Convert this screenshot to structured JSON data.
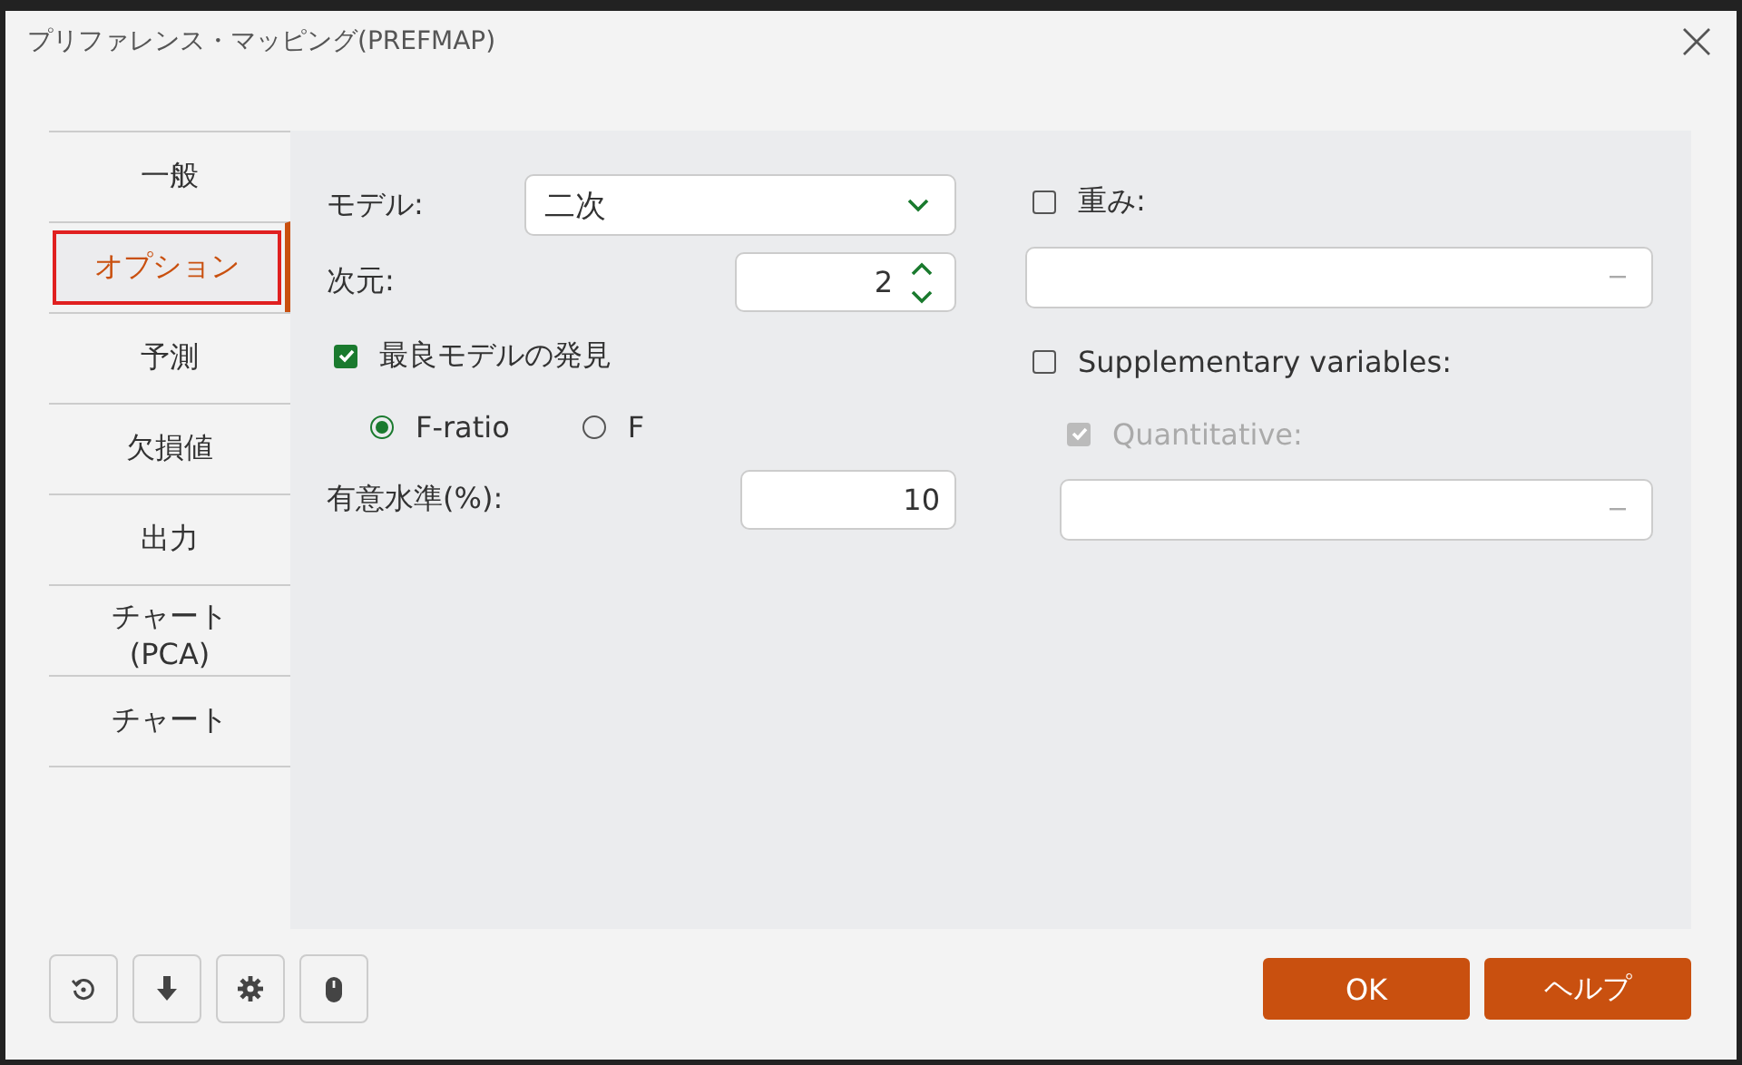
{
  "window": {
    "title": "プリファレンス・マッピング(PREFMAP)"
  },
  "tabs": [
    {
      "label": "一般",
      "selected": false
    },
    {
      "label": "オプション",
      "selected": true
    },
    {
      "label": "予測",
      "selected": false
    },
    {
      "label": "欠損値",
      "selected": false
    },
    {
      "label": "出力",
      "selected": false
    },
    {
      "label": "チャート (PCA)",
      "selected": false
    },
    {
      "label": "チャート",
      "selected": false
    }
  ],
  "options": {
    "model": {
      "label": "モデル:",
      "value": "二次"
    },
    "dimensions": {
      "label": "次元:",
      "value": "2"
    },
    "best_model": {
      "label": "最良モデルの発見",
      "checked": true
    },
    "criteria": [
      {
        "label": "F-ratio",
        "selected": true
      },
      {
        "label": "F",
        "selected": false
      }
    ],
    "significance": {
      "label": "有意水準(%):",
      "value": "10"
    }
  },
  "weights": {
    "label": "重み:",
    "checked": false
  },
  "supplementary": {
    "label": "Supplementary variables:",
    "checked": false,
    "quantitative": {
      "label": "Quantitative:",
      "checked": true,
      "disabled": true
    }
  },
  "buttons": [
    {
      "label": "OK"
    },
    {
      "label": "ヘルプ"
    }
  ]
}
